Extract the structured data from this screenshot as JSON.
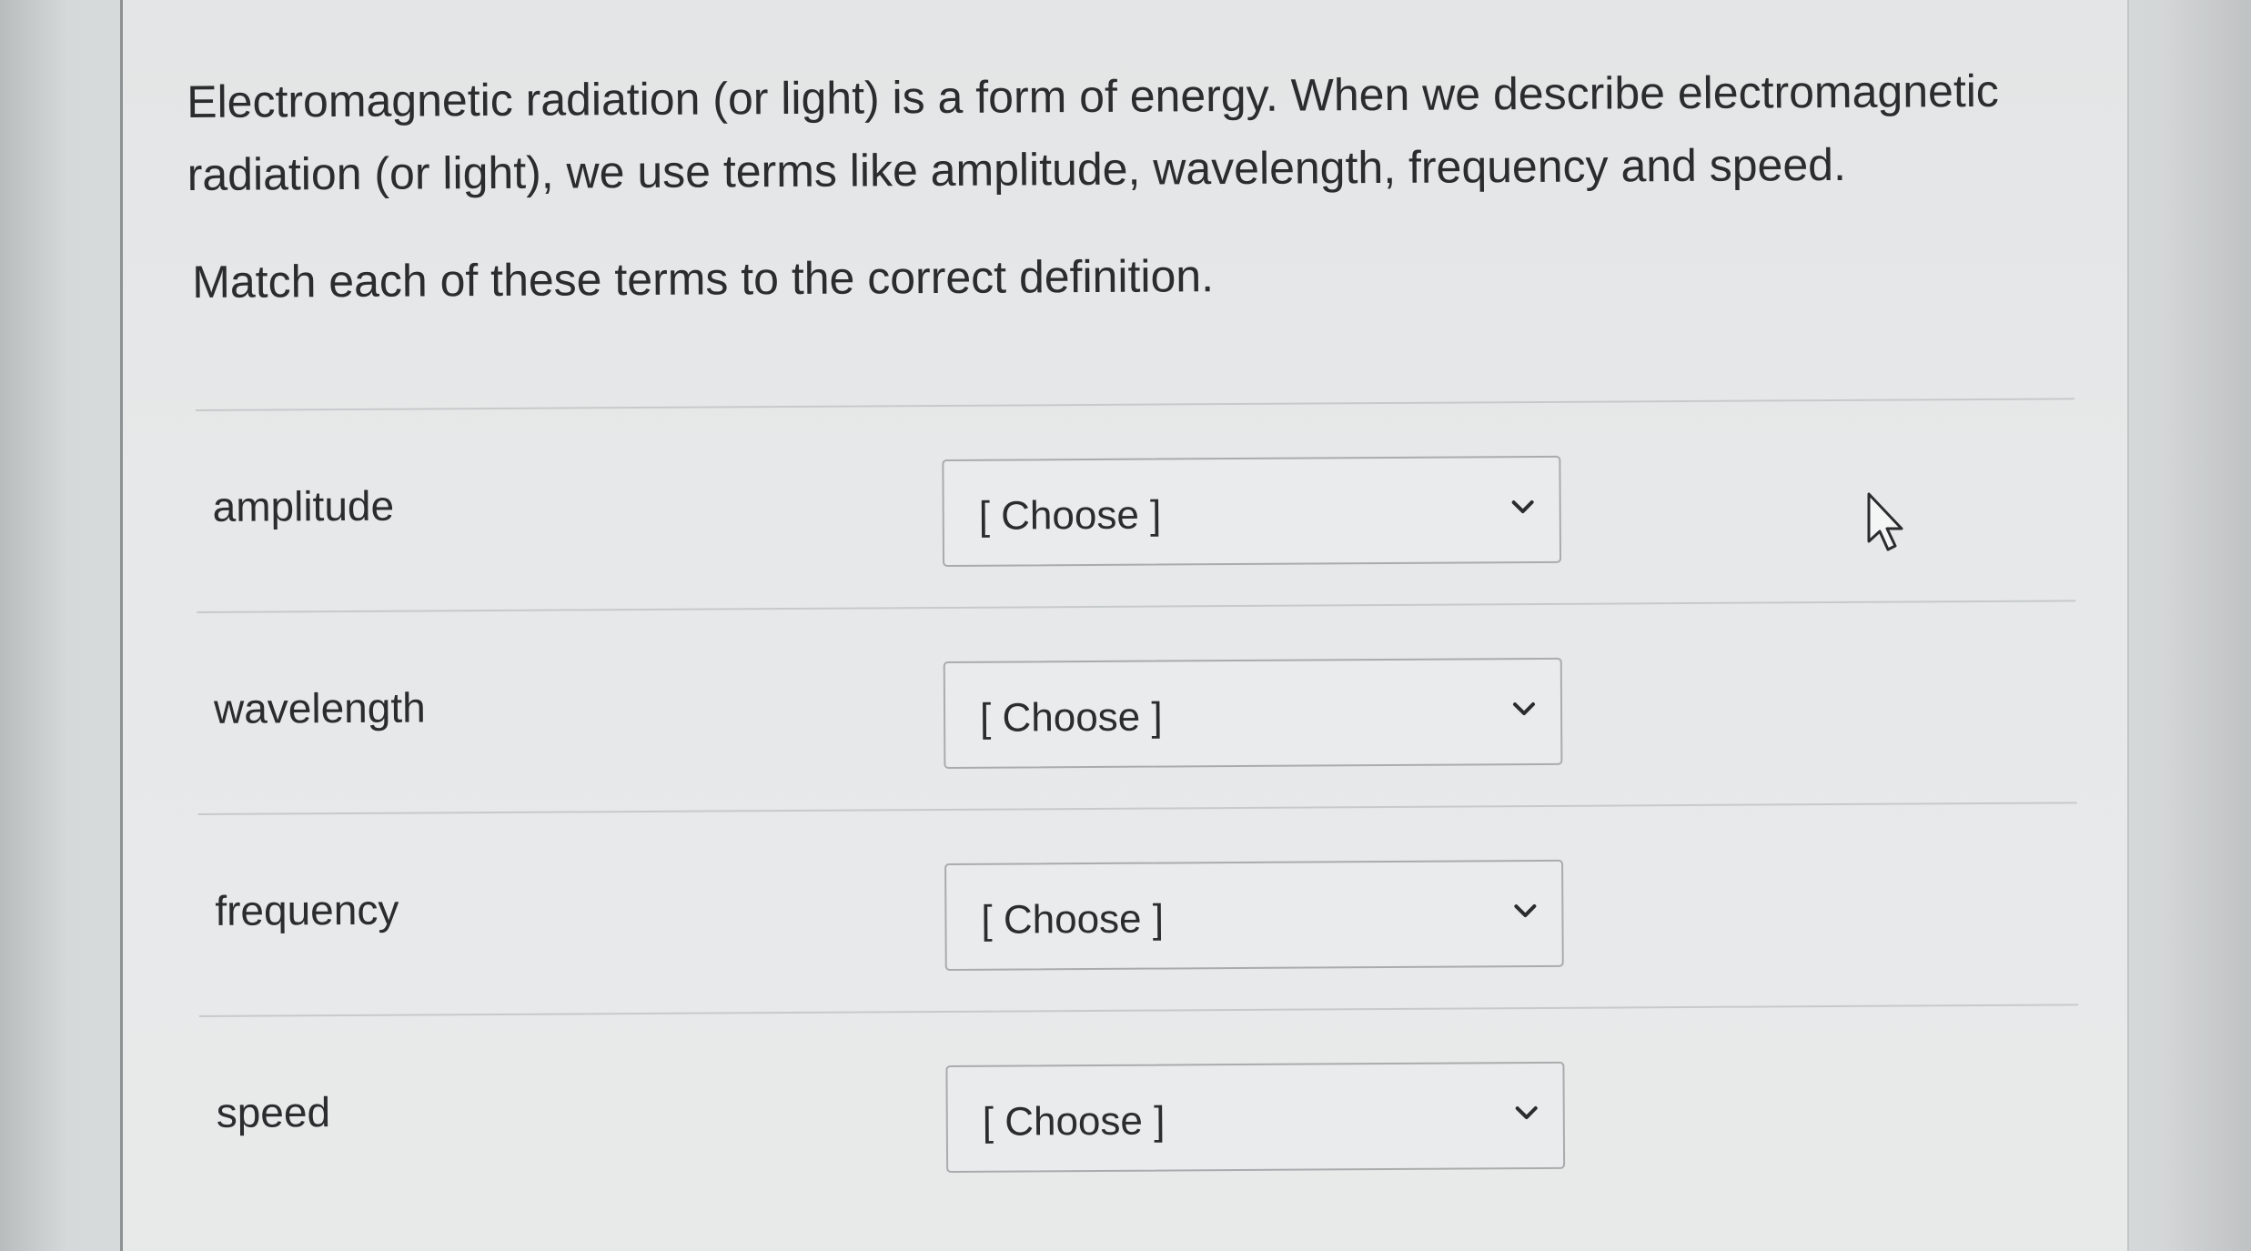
{
  "question": {
    "intro": "Electromagnetic radiation (or light) is a form of energy.  When we describe electromagnetic radiation (or light), we use terms like amplitude, wavelength, frequency and speed.",
    "instruction": "Match each of these terms to the correct definition."
  },
  "matches": [
    {
      "term": "amplitude",
      "selected": "[ Choose ]"
    },
    {
      "term": "wavelength",
      "selected": "[ Choose ]"
    },
    {
      "term": "frequency",
      "selected": "[ Choose ]"
    },
    {
      "term": "speed",
      "selected": "[ Choose ]"
    }
  ],
  "icons": {
    "dropdown": "chevron-down-icon",
    "pointer": "mouse-cursor-icon"
  }
}
